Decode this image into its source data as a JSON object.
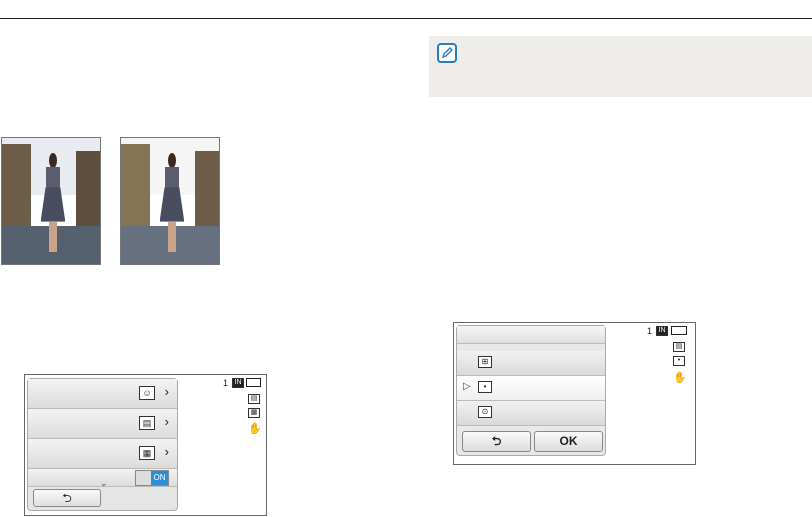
{
  "note": {
    "icon": "note-pencil-icon"
  },
  "photos": [
    {
      "name": "photo-before",
      "sky": "#e8ebef",
      "wall": "#7a6a55",
      "street": "#5a5f6a"
    },
    {
      "name": "photo-after",
      "sky": "#f4f4f4",
      "wall": "#8a7a62",
      "street": "#6a707c"
    }
  ],
  "menu_left": {
    "rows": [
      {
        "icon": "face-detection-icon",
        "glyph": "☺"
      },
      {
        "icon": "photo-size-icon",
        "glyph": "▤"
      },
      {
        "icon": "quality-icon",
        "glyph": "▦"
      },
      {
        "icon": "toggle-switch",
        "toggle_label": "ON"
      }
    ],
    "back_label": "⮌",
    "status": {
      "count": "1",
      "memory_icon": "internal-memory-icon",
      "battery_icon": "battery-icon"
    }
  },
  "menu_right": {
    "rows": [
      {
        "icon": "multi-af-icon",
        "glyph": "⊞",
        "selected": false
      },
      {
        "icon": "center-af-icon",
        "glyph": "•",
        "selected": true
      },
      {
        "icon": "tracking-af-icon",
        "glyph": "⊙",
        "selected": false
      }
    ],
    "back_label": "⮌",
    "ok_label": "OK",
    "status": {
      "count": "1",
      "memory_icon": "internal-memory-icon",
      "battery_icon": "battery-icon"
    }
  }
}
